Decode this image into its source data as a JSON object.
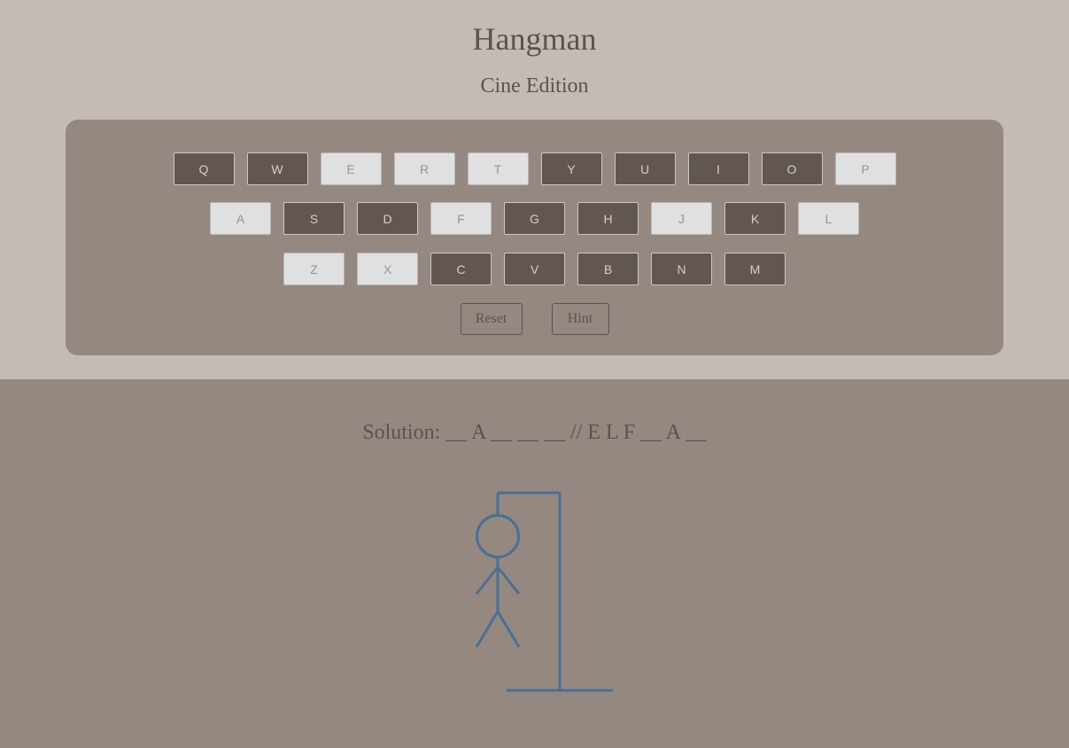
{
  "header": {
    "title": "Hangman",
    "subtitle": "Cine Edition"
  },
  "keyboard": {
    "rows": [
      [
        {
          "letter": "Q",
          "state": "active"
        },
        {
          "letter": "W",
          "state": "active"
        },
        {
          "letter": "E",
          "state": "used"
        },
        {
          "letter": "R",
          "state": "used"
        },
        {
          "letter": "T",
          "state": "used"
        },
        {
          "letter": "Y",
          "state": "active"
        },
        {
          "letter": "U",
          "state": "active"
        },
        {
          "letter": "I",
          "state": "active"
        },
        {
          "letter": "O",
          "state": "active"
        },
        {
          "letter": "P",
          "state": "used"
        }
      ],
      [
        {
          "letter": "A",
          "state": "used"
        },
        {
          "letter": "S",
          "state": "active"
        },
        {
          "letter": "D",
          "state": "active"
        },
        {
          "letter": "F",
          "state": "used"
        },
        {
          "letter": "G",
          "state": "active"
        },
        {
          "letter": "H",
          "state": "active"
        },
        {
          "letter": "J",
          "state": "used"
        },
        {
          "letter": "K",
          "state": "active"
        },
        {
          "letter": "L",
          "state": "used"
        }
      ],
      [
        {
          "letter": "Z",
          "state": "used"
        },
        {
          "letter": "X",
          "state": "used"
        },
        {
          "letter": "C",
          "state": "active"
        },
        {
          "letter": "V",
          "state": "active"
        },
        {
          "letter": "B",
          "state": "active"
        },
        {
          "letter": "N",
          "state": "active"
        },
        {
          "letter": "M",
          "state": "active"
        }
      ]
    ]
  },
  "controls": {
    "reset_label": "Reset",
    "hint_label": "Hint"
  },
  "solution": {
    "text": "Solution: __ A __ __ __ // E L F __ A __"
  },
  "colors": {
    "top_background": "#c5bbb6",
    "main_background": "#958880",
    "key_active": "#615651",
    "key_used": "#dfe0e2",
    "text": "#5d524d",
    "hangman_stroke": "#4a6f96"
  },
  "hangman": {
    "parts_shown": [
      "gallows",
      "head",
      "body",
      "left-arm",
      "right-arm",
      "left-leg",
      "right-leg"
    ]
  }
}
